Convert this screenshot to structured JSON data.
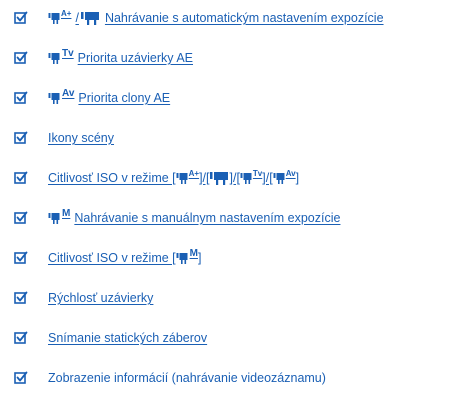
{
  "items": [
    {
      "text": "Nahrávanie s automatickým nastavením expozície",
      "icon": "movie-auto-exposure-icon"
    },
    {
      "text": "Priorita uzávierky AE",
      "icon": "movie-tv-icon"
    },
    {
      "text": "Priorita clony AE",
      "icon": "movie-av-icon"
    },
    {
      "text": "Ikony scény",
      "icon": null
    },
    {
      "text": "Citlivosť ISO v režime [",
      "suffix": "]",
      "icon": null
    },
    {
      "text": "Nahrávanie s manuálnym nastavením expozície",
      "icon": "movie-manual-icon"
    },
    {
      "text": "Citlivosť ISO v režime [",
      "suffix": "]",
      "icon": null
    },
    {
      "text": "Rýchlosť uzávierky",
      "icon": null
    },
    {
      "text": "Snímanie statických záberov",
      "icon": null
    },
    {
      "text": "Zobrazenie informácií (nahrávanie videozáznamu)",
      "icon": null
    }
  ],
  "mode_labels": {
    "auto_plus": "A+",
    "tv": "Tv",
    "av": "Av",
    "m": "M",
    "slash": "/",
    "sep": "]/["
  },
  "colors": {
    "link": "#1a5fb4",
    "check": "#1a5fb4"
  }
}
